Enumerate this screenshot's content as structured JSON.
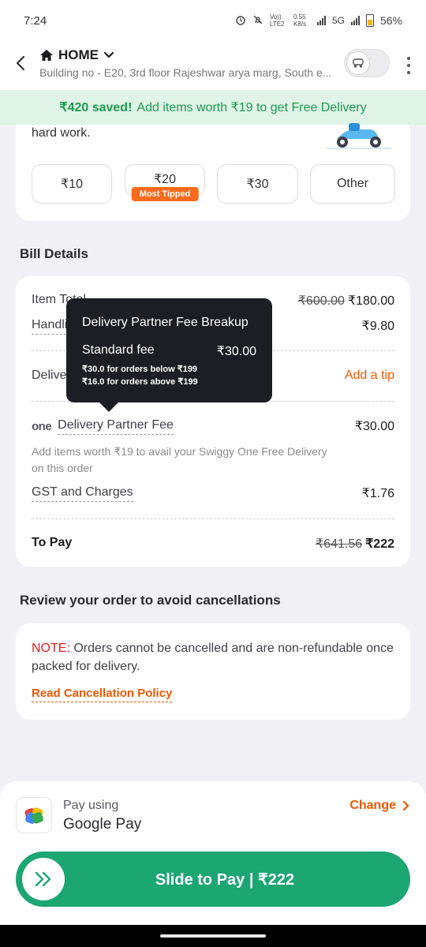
{
  "status_bar": {
    "time": "7:24",
    "net_label": "Vo)) LTE2",
    "net_speed": "0.55 K8/s",
    "net_type": "5G",
    "battery": "56%"
  },
  "header": {
    "location_title": "HOME",
    "address": "Building no - E20, 3rd floor Rajeshwar arya marg, South e..."
  },
  "banner": {
    "saved": "₹420 saved!",
    "message": "Add items worth ₹19 to get Free Delivery"
  },
  "tip": {
    "text": "hard work.",
    "options": [
      {
        "label": "₹10"
      },
      {
        "label": "₹20",
        "badge": "Most Tipped"
      },
      {
        "label": "₹30"
      },
      {
        "label": "Other"
      }
    ]
  },
  "bill": {
    "section_title": "Bill Details",
    "item_total_label": "Item Total",
    "item_total_original": "₹600.00",
    "item_total": "₹180.00",
    "handling_label": "Handling Fee",
    "handling_value": "₹9.80",
    "delivery_tip_label": "Delivery Tip",
    "add_tip": "Add a tip",
    "one_logo": "one",
    "partner_fee_label": "Delivery Partner Fee",
    "partner_fee_value": "₹30.00",
    "one_note": "Add items worth ₹19 to avail your Swiggy One Free Delivery on this order",
    "gst_label": "GST and Charges",
    "gst_value": "₹1.76",
    "to_pay_label": "To Pay",
    "to_pay_original": "₹641.56",
    "to_pay": "₹222"
  },
  "tooltip": {
    "title": "Delivery Partner Fee Breakup",
    "standard_label": "Standard fee",
    "standard_value": "₹30.00",
    "line1": "₹30.0 for orders below ₹199",
    "line2": "₹16.0 for orders above ₹199"
  },
  "review": {
    "section_title": "Review your order to avoid cancellations",
    "note_tag": "NOTE:",
    "note_text": "Orders cannot be cancelled and are non-refundable once packed for delivery.",
    "policy_link": "Read Cancellation Policy"
  },
  "payment": {
    "pay_using": "Pay using",
    "method": "Google Pay",
    "change": "Change",
    "slide_label": "Slide to Pay | ₹222"
  },
  "colors": {
    "accent": "#f15700",
    "success": "#1ba672",
    "banner_bg": "#dff3e6",
    "banner_text": "#1f9a54",
    "badge": "#fa6b1c",
    "tooltip_bg": "#1d1e24"
  }
}
